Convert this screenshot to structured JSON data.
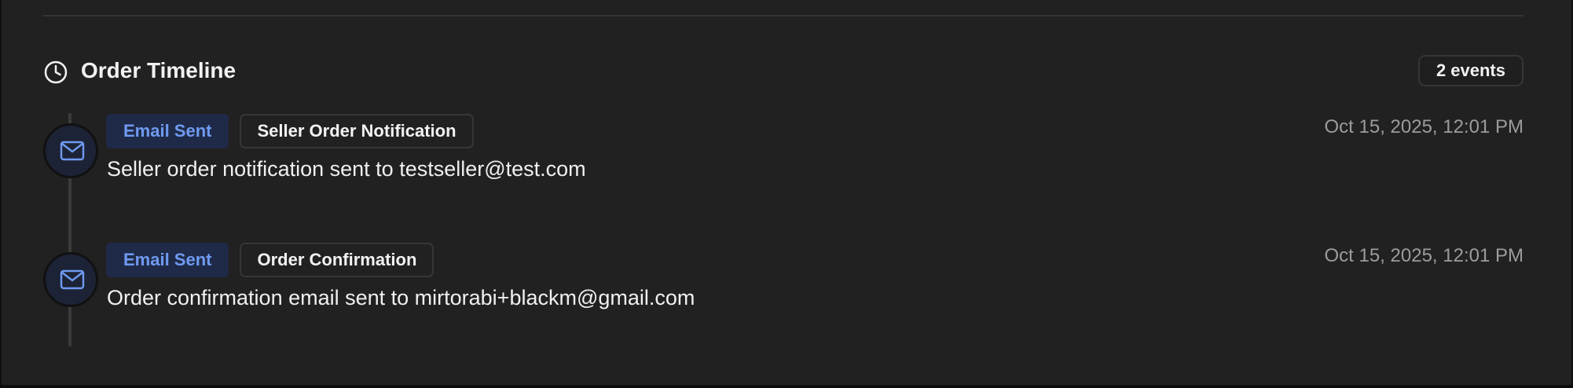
{
  "timeline": {
    "title": "Order Timeline",
    "event_count": "2 events",
    "events": [
      {
        "type": "Email Sent",
        "name": "Seller Order Notification",
        "description": "Seller order notification sent to testseller@test.com",
        "timestamp": "Oct 15, 2025, 12:01 PM",
        "icon": "mail-icon"
      },
      {
        "type": "Email Sent",
        "name": "Order Confirmation",
        "description": "Order confirmation email sent to mirtorabi+blackm@gmail.com",
        "timestamp": "Oct 15, 2025, 12:01 PM",
        "icon": "mail-icon"
      }
    ]
  },
  "colors": {
    "panel_background": "#212121",
    "email_badge_background": "#1f2a48",
    "email_badge_text": "#6f9af0",
    "timestamp_text": "#9c9c9c"
  }
}
